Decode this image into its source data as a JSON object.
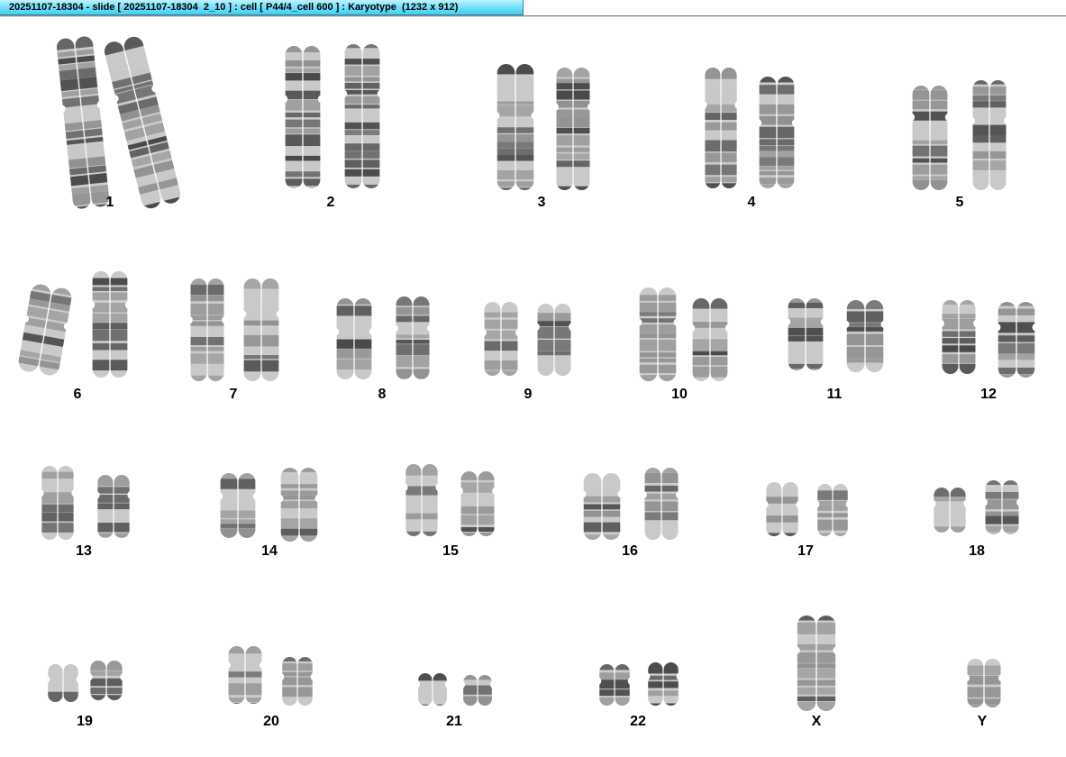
{
  "window": {
    "title": "20251107-18304 - slide [ 20251107-18304  2_10 ] : cell [ P44/4_cell 600 ] : Karyotype  (1232 x 912)"
  },
  "karyotype": {
    "chromosomes": [
      {
        "id": "1",
        "label": "1"
      },
      {
        "id": "2",
        "label": "2"
      },
      {
        "id": "3",
        "label": "3"
      },
      {
        "id": "4",
        "label": "4"
      },
      {
        "id": "5",
        "label": "5"
      },
      {
        "id": "6",
        "label": "6"
      },
      {
        "id": "7",
        "label": "7"
      },
      {
        "id": "8",
        "label": "8"
      },
      {
        "id": "9",
        "label": "9"
      },
      {
        "id": "10",
        "label": "10"
      },
      {
        "id": "11",
        "label": "11"
      },
      {
        "id": "12",
        "label": "12"
      },
      {
        "id": "13",
        "label": "13"
      },
      {
        "id": "14",
        "label": "14"
      },
      {
        "id": "15",
        "label": "15"
      },
      {
        "id": "16",
        "label": "16"
      },
      {
        "id": "17",
        "label": "17"
      },
      {
        "id": "18",
        "label": "18"
      },
      {
        "id": "19",
        "label": "19"
      },
      {
        "id": "20",
        "label": "20"
      },
      {
        "id": "21",
        "label": "21"
      },
      {
        "id": "22",
        "label": "22"
      },
      {
        "id": "X",
        "label": "X"
      },
      {
        "id": "Y",
        "label": "Y"
      }
    ]
  },
  "colors": {
    "title_bar": "#79e2fb",
    "chromatin_dark": "#3a3a3a",
    "chromatin_mid": "#8a8a8a",
    "chromatin_light": "#c8c8c8",
    "background": "#ffffff"
  }
}
